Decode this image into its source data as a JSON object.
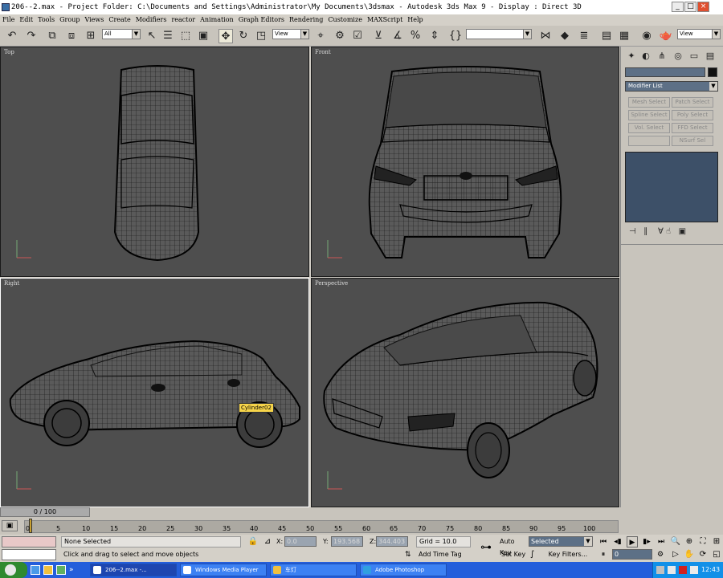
{
  "window": {
    "title": "206--2.max - Project Folder: C:\\Documents and Settings\\Administrator\\My Documents\\3dsmax - Autodesk 3ds Max 9 - Display : Direct 3D",
    "controls": [
      "_",
      "□",
      "×"
    ]
  },
  "menu": [
    "File",
    "Edit",
    "Tools",
    "Group",
    "Views",
    "Create",
    "Modifiers",
    "reactor",
    "Animation",
    "Graph Editors",
    "Rendering",
    "Customize",
    "MAXScript",
    "Help"
  ],
  "toolbar": {
    "selection_filter": "All",
    "ref_coord": "View",
    "named_selection": "",
    "render_view": "View"
  },
  "viewports": [
    {
      "label": "Top"
    },
    {
      "label": "Front"
    },
    {
      "label": "Right",
      "tooltip": "Cylinder02"
    },
    {
      "label": "Perspective"
    }
  ],
  "command_panel": {
    "name_field": "",
    "modifier_list": "Modifier List",
    "modifier_buttons": [
      "Mesh Select",
      "Patch Select",
      "Spline Select",
      "Poly Select",
      "Vol. Select",
      "FFD Select",
      "",
      "NSurf Sel"
    ]
  },
  "timeline": {
    "frame": "0 / 100",
    "ticks": [
      "0",
      "5",
      "10",
      "15",
      "20",
      "25",
      "30",
      "35",
      "40",
      "45",
      "50",
      "55",
      "60",
      "65",
      "70",
      "75",
      "80",
      "85",
      "90",
      "95",
      "100"
    ]
  },
  "status": {
    "selection": "None Selected",
    "prompt": "Click and drag to select and move objects",
    "x_value": "0.0",
    "y_value": "193.568",
    "z_value": "344.403",
    "grid": "Grid = 10.0",
    "add_time_tag": "Add Time Tag",
    "auto_key": "Auto Key",
    "set_key": "Set Key",
    "key_mode": "Selected",
    "key_filters": "Key Filters...",
    "current_frame": "0"
  },
  "taskbar": {
    "tasks": [
      "206--2.max -...",
      "Windows Media Player",
      "车灯",
      "Adobe Photoshop"
    ],
    "clock": "12:43"
  }
}
